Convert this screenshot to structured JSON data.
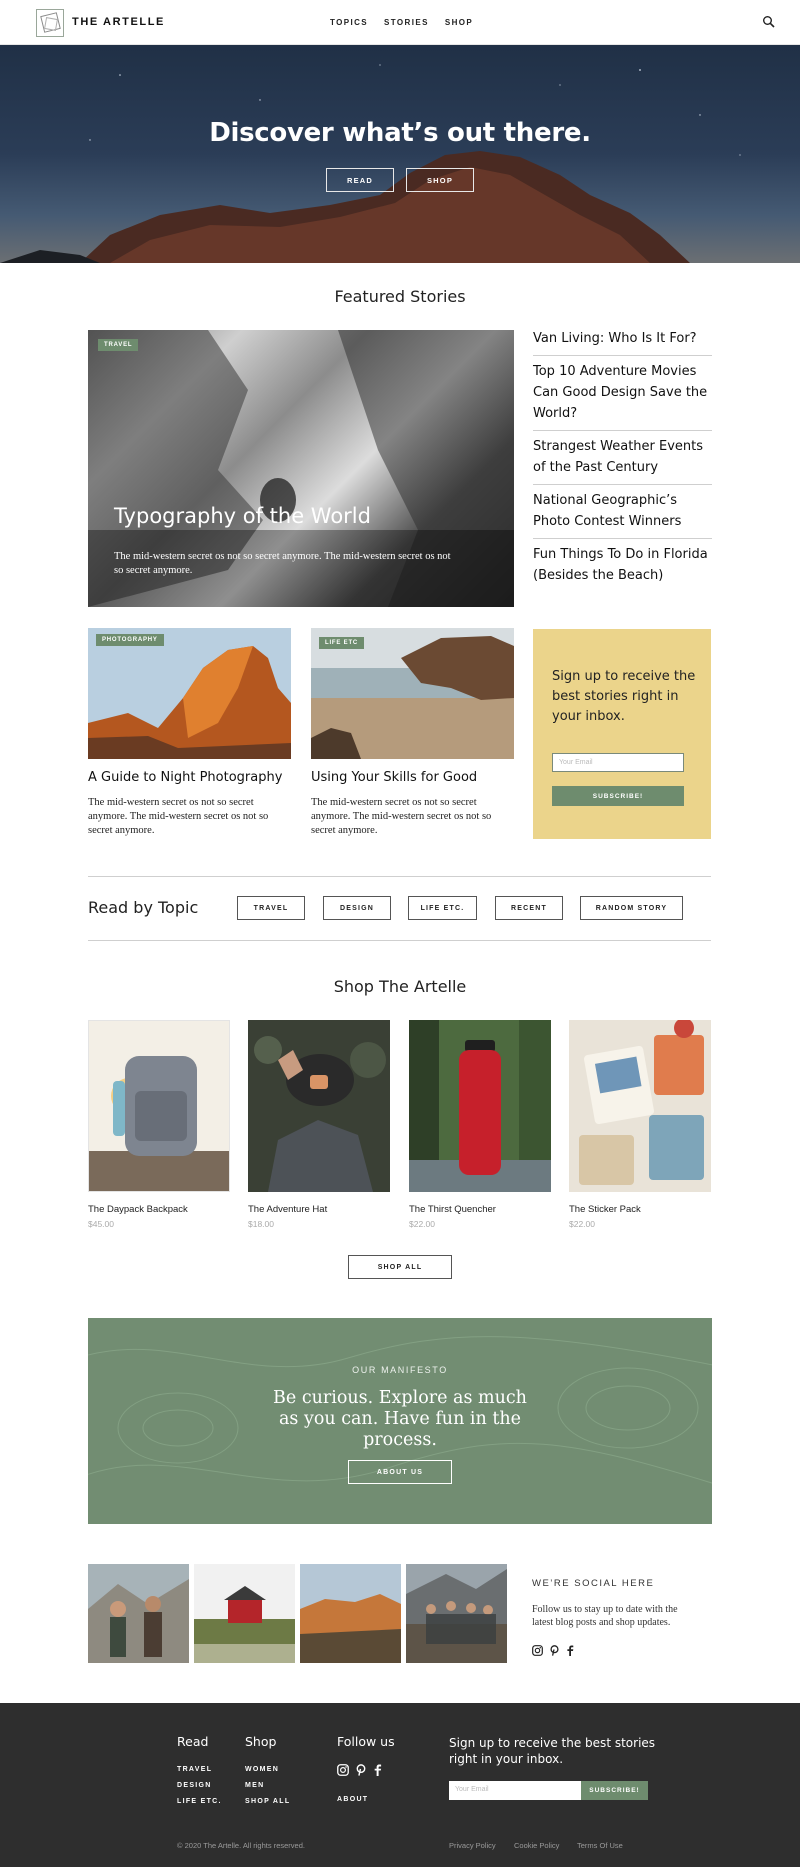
{
  "nav": {
    "brand": "THE ARTELLE",
    "links": [
      "TOPICS",
      "STORIES",
      "SHOP"
    ],
    "icons": {
      "logo": "artelle-logo-icon",
      "search": "search-icon"
    }
  },
  "hero": {
    "headline": "Discover what’s out there.",
    "read_label": "READ",
    "shop_label": "SHOP"
  },
  "featured": {
    "section_title": "Featured Stories",
    "main": {
      "tag": "TRAVEL",
      "title": "Typography of the World",
      "excerpt": "The mid-western secret os not so secret anymore. The mid-western secret os not so secret anymore."
    },
    "side_list": [
      "Van Living: Who Is It For?",
      "Top 10 Adventure Movies",
      "Can Good Design Save the World?",
      "Strangest Weather Events of the Past Century",
      "National Geographic’s Photo Contest Winners",
      "Fun Things To Do in Florida (Besides the Beach)"
    ],
    "cards": [
      {
        "tag": "PHOTOGRAPHY",
        "title": "A Guide to Night Photography",
        "excerpt": "The mid-western secret os not so secret anymore. The mid-western secret os not so secret anymore."
      },
      {
        "tag": "LIFE ETC",
        "title": "Using Your Skills for Good",
        "excerpt": "The mid-western secret os not so secret anymore. The mid-western secret os not so secret anymore."
      }
    ],
    "signup": {
      "text": "Sign up to receive the best stories right in your inbox.",
      "placeholder": "Your Email",
      "button": "SUBSCRIBE!"
    }
  },
  "topics": {
    "title": "Read by Topic",
    "buttons": [
      "TRAVEL",
      "DESIGN",
      "LIFE ETC.",
      "RECENT",
      "RANDOM STORY"
    ]
  },
  "shop": {
    "section_title": "Shop The Artelle",
    "products": [
      {
        "name": "The Daypack Backpack",
        "price": "$45.00"
      },
      {
        "name": "The Adventure Hat",
        "price": "$18.00"
      },
      {
        "name": "The Thirst Quencher",
        "price": "$22.00"
      },
      {
        "name": "The Sticker Pack",
        "price": "$22.00"
      }
    ],
    "shop_all": "SHOP ALL"
  },
  "manifesto": {
    "label": "OUR MANIFESTO",
    "text": "Be curious. Explore as much as you can. Have fun in the process.",
    "button": "ABOUT US"
  },
  "social": {
    "label": "WE’RE SOCIAL HERE",
    "text": "Follow us to stay up to date with the latest blog posts and shop updates.",
    "icons": [
      "instagram-icon",
      "pinterest-icon",
      "facebook-icon"
    ]
  },
  "footer": {
    "read": {
      "heading": "Read",
      "links": [
        "TRAVEL",
        "DESIGN",
        "LIFE ETC."
      ]
    },
    "shop": {
      "heading": "Shop",
      "links": [
        "WOMEN",
        "MEN",
        "SHOP ALL"
      ]
    },
    "follow": {
      "heading": "Follow us",
      "about": "ABOUT"
    },
    "signup_text": "Sign up to receive the best stories right in your inbox.",
    "email_placeholder": "Your Email",
    "subscribe": "SUBSCRIBE!",
    "copyright": "© 2020 The Artelle. All rights reserved.",
    "legal": [
      "Privacy Policy",
      "Cookie Policy",
      "Terms Of Use"
    ]
  },
  "colors": {
    "accent_green": "#6e8c6e",
    "signup_yellow": "#ebd48b",
    "manifesto_green": "#728d72",
    "footer_dark": "#2e2e2e"
  }
}
